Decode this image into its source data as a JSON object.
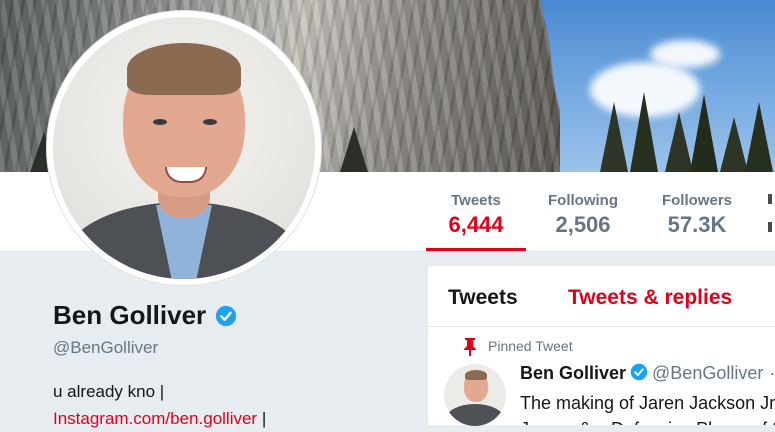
{
  "profile": {
    "name": "Ben Golliver",
    "handle": "@BenGolliver",
    "bio_line1": "u already kno |",
    "bio_link": "Instagram.com/ben.golliver",
    "bio_link_suffix": " |"
  },
  "stats": [
    {
      "label": "Tweets",
      "value": "6,444",
      "active": true
    },
    {
      "label": "Following",
      "value": "2,506",
      "active": false
    },
    {
      "label": "Followers",
      "value": "57.3K",
      "active": false
    }
  ],
  "tabs": {
    "tweets": "Tweets",
    "tweets_replies": "Tweets & replies"
  },
  "pinned_tweet": {
    "pinned_label": "Pinned Tweet",
    "author_name": "Ben Golliver",
    "author_handle": "@BenGolliver",
    "separator": "·",
    "text_line1": "The making of Jaren Jackson Jr.:",
    "text_line2": "Jouver & a Defensive Player of t"
  },
  "colors": {
    "accent": "#e0001a",
    "verified": "#1da1f2",
    "muted": "#657786",
    "background": "#e6ecf0"
  },
  "icons": {
    "verified": "verified-badge-icon",
    "pin": "pin-icon"
  }
}
